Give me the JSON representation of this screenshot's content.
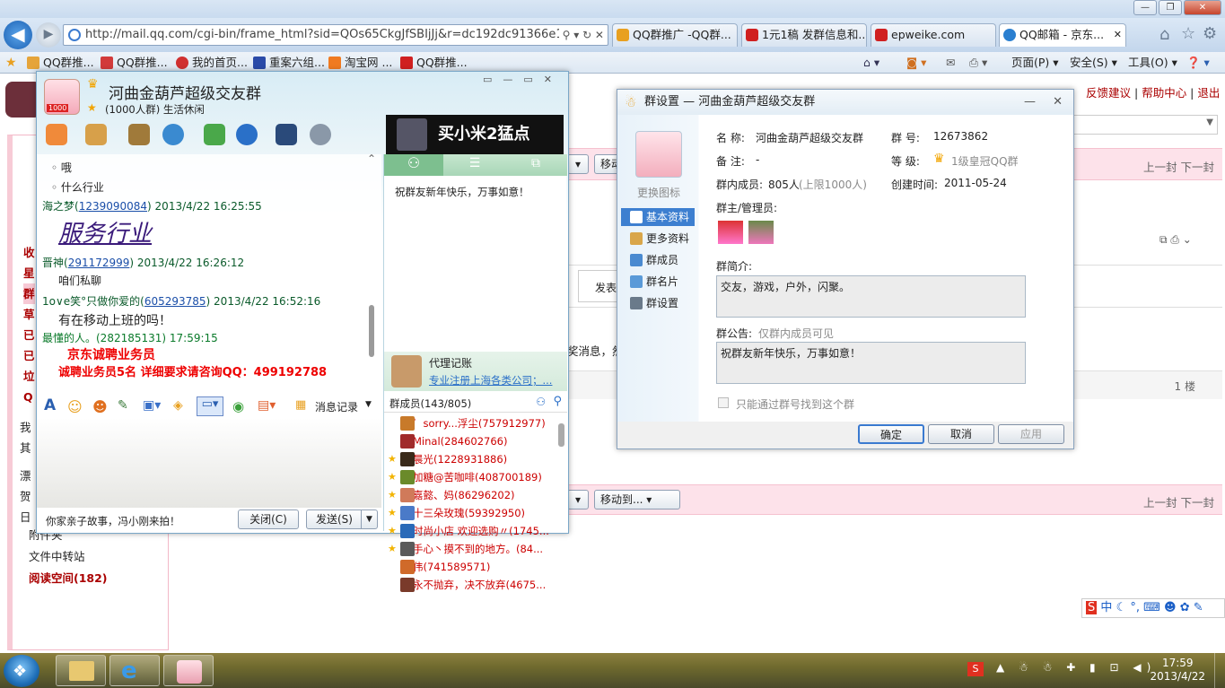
{
  "browser": {
    "address": "http://mail.qq.com/cgi-bin/frame_html?sid=QOs65CkgJfSBIjJj&r=dc192dc91366e148d9",
    "tabs": [
      {
        "label": "QQ群推广 -QQ群...",
        "color": "#e8a020"
      },
      {
        "label": "1元1稿 发群信息和...",
        "color": "#d02020"
      },
      {
        "label": "epweike.com",
        "color": "#d02020"
      },
      {
        "label": "QQ邮箱 - 京东...",
        "color": "#2a7fd0"
      }
    ],
    "favorites": [
      "QQ群推...",
      "QQ群推...",
      "我的首页...",
      "重案六组...",
      "淘宝网 ...",
      "QQ群推..."
    ],
    "commands": {
      "page": "页面(P)",
      "safety": "安全(S)",
      "tools": "工具(O)"
    }
  },
  "mailpage": {
    "top_links": [
      "反馈建议",
      "帮助中心",
      "退出"
    ],
    "pager": "上一封 下一封",
    "pager2": "上一封 下一封",
    "moveto": "移动到...",
    "move_short": "移动",
    "floor": "1 楼",
    "reply_label": "发表",
    "notice_frag": "奖消息，然",
    "left_items": [
      "收",
      "星",
      "群",
      "草",
      "已",
      "已",
      "垃",
      "Q"
    ],
    "left_bottom": [
      "文件中转站",
      "阅读空间(182)"
    ],
    "left_small": [
      "我",
      "其",
      "漂",
      "贺",
      "日",
      "附件夹"
    ]
  },
  "chat": {
    "group_name": "河曲金葫芦超级交友群",
    "group_meta": "(1000人群) 生活休闲",
    "avatar_badge": "1000",
    "ad_text": "买小米2猛点",
    "messages": {
      "l1": "哦",
      "l2": "什么行业",
      "s1_name": "海之梦(",
      "s1_id": "1239090084",
      "s1_time": ") 2013/4/22 16:25:55",
      "s1_text": "服务行业",
      "s2_name": "晋神(",
      "s2_id": "291172999",
      "s2_time": ") 2013/4/22 16:26:12",
      "s2_text": "咱们私聊",
      "s3_name": "1o∨e笑°只做你爱的(",
      "s3_id": "605293785",
      "s3_time": ") 2013/4/22 16:52:16",
      "s3_text": "有在移动上班的吗！",
      "s4_header": "最懂的人。(282185131)  17:59:15",
      "s4_line1": "京东诚聘业务员",
      "s4_line2": "诚聘业务员5名 详细要求请咨询QQ：499192788"
    },
    "toolbar": {
      "history": "消息记录"
    },
    "footer_text": "你家亲子故事，冯小刚来拍！",
    "close_btn": "关闭(C)",
    "send_btn": "发送(S)",
    "announcement": "祝群友新年快乐，万事如意！",
    "agent_title": "代理记账",
    "agent_text": "专业注册上海各类公司；...",
    "members_header": "群成员(143/805)",
    "members": [
      {
        "name": "゜sorry...浮尘(757912977)",
        "star": false,
        "color": "#c87a2a"
      },
      {
        "name": "Minal(284602766)",
        "star": false,
        "color": "#a02a2a"
      },
      {
        "name": "晨光(1228931886)",
        "star": true,
        "color": "#3a2a1a"
      },
      {
        "name": "加糖@苦咖啡(408700189)",
        "star": true,
        "color": "#6a8a2a"
      },
      {
        "name": "嘉懿、妈(86296202)",
        "star": true,
        "color": "#d07a5a"
      },
      {
        "name": "十三朵玫瑰(59392950)",
        "star": true,
        "color": "#4a7ac8"
      },
      {
        "name": "时尚小店 欢迎选购〃(1745...",
        "star": true,
        "color": "#2a6ab8"
      },
      {
        "name": "手心丶摸不到的地方。(84...",
        "star": true,
        "color": "#5a5a5a"
      },
      {
        "name": "伟(741589571)",
        "star": false,
        "color": "#d06a2a"
      },
      {
        "name": "永不抛弃，决不放弃(4675...",
        "star": false,
        "color": "#7a3a2a"
      }
    ]
  },
  "dialog": {
    "title": "群设置 — 河曲金葫芦超级交友群",
    "change_icon": "更换图标",
    "sidebar": [
      "基本资料",
      "更多资料",
      "群成员",
      "群名片",
      "群设置"
    ],
    "name_label": "名   称:",
    "name_value": "河曲金葫芦超级交友群",
    "num_label": "群   号:",
    "num_value": "12673862",
    "note_label": "备   注:",
    "note_value": "-",
    "level_label": "等   级:",
    "level_value": "1级皇冠QQ群",
    "members_label": "群内成员:",
    "members_value": "805人",
    "members_limit": "(上限1000人)",
    "created_label": "创建时间:",
    "created_value": "2011-05-24",
    "admins_label": "群主/管理员:",
    "intro_label": "群简介:",
    "intro_value": "交友，游戏，户外，闪聚。",
    "notice_label": "群公告:",
    "notice_hint": "仅群内成员可见",
    "notice_value": "祝群友新年快乐，万事如意！",
    "checkbox_label": "只能通过群号找到这个群",
    "ok": "确定",
    "cancel": "取消",
    "apply": "应用"
  },
  "taskbar": {
    "time": "17:59",
    "date": "2013/4/22",
    "ime": "中"
  }
}
